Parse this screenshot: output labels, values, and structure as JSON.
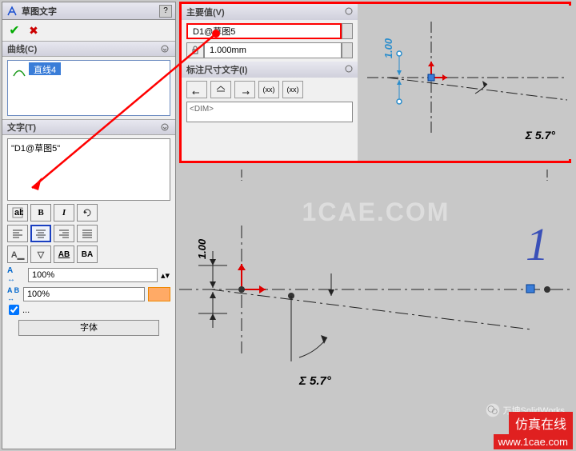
{
  "panel": {
    "title": "草图文字",
    "ok": "✔",
    "cancel": "✖",
    "help": "?"
  },
  "curves": {
    "head": "曲线(C)",
    "selected": "直线4"
  },
  "text_section": {
    "head": "文字(T)",
    "value": "\"D1@草图5\""
  },
  "toolbar": {
    "bold": "B",
    "italic": "I"
  },
  "widths": {
    "a_label": "A",
    "ab_label": "A B",
    "percent1": "100%",
    "percent2": "100%",
    "font_btn": "字体"
  },
  "highlight": {
    "main_value_head": "主要值(V)",
    "name_field": "D1@草图5",
    "value_field": "1.000mm",
    "dim_text_head": "标注尺寸文字(I)",
    "dim_placeholder": "<DIM>",
    "xx1": "(xx)",
    "xx2": "(xx)"
  },
  "drawing": {
    "dim_value": "1.00",
    "angle_label": "Σ  5.7°"
  },
  "watermark": "1CAE.COM",
  "footer": {
    "wechat": "万坤SolidWorks",
    "cn": "仿真在线",
    "url": "www.1cae.com"
  }
}
